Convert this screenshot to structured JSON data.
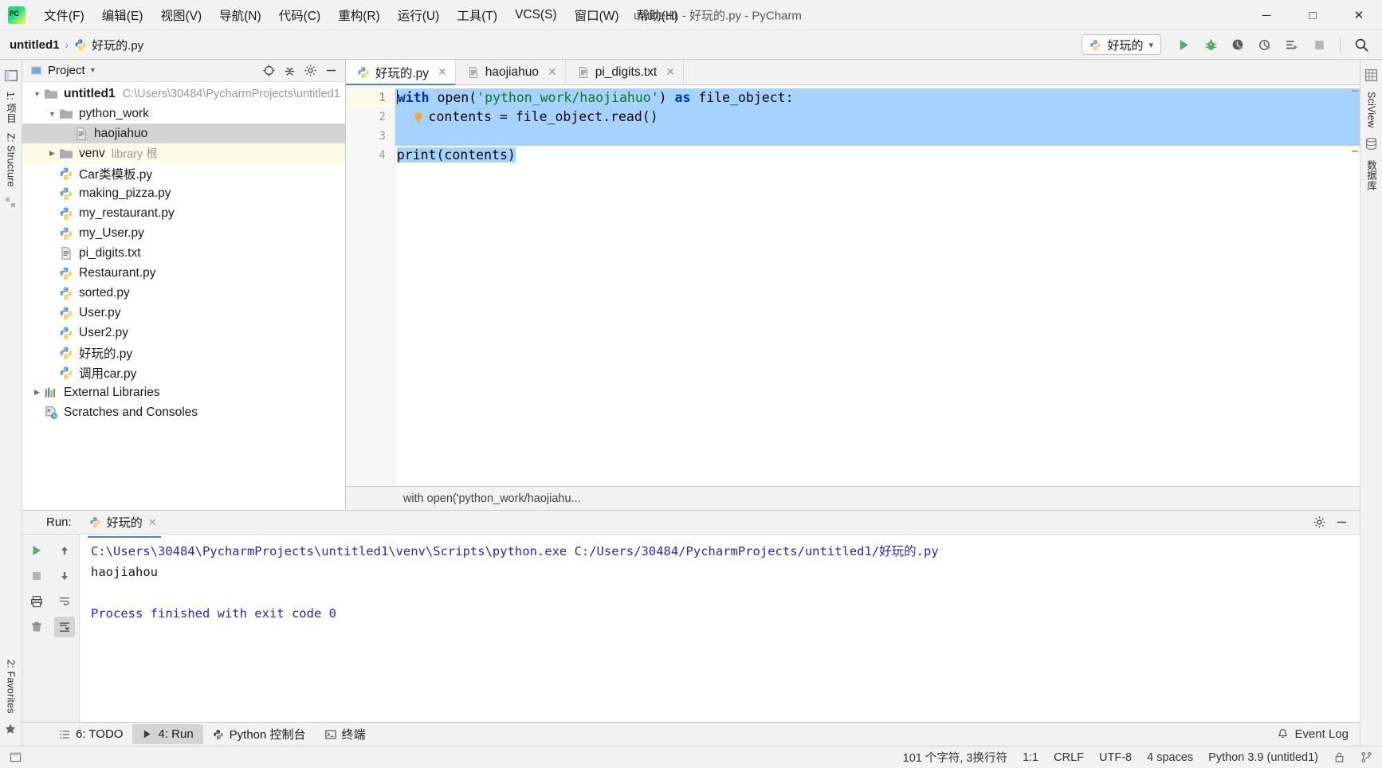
{
  "window": {
    "title": "untitled1 - 好玩的.py - PyCharm",
    "minimize": "─",
    "maximize": "□",
    "close": "✕"
  },
  "menubar": [
    {
      "label": "文件(F)",
      "key": "F"
    },
    {
      "label": "编辑(E)",
      "key": "E"
    },
    {
      "label": "视图(V)",
      "key": "V"
    },
    {
      "label": "导航(N)",
      "key": "N"
    },
    {
      "label": "代码(C)",
      "key": "C"
    },
    {
      "label": "重构(R)",
      "key": "R"
    },
    {
      "label": "运行(U)",
      "key": "U"
    },
    {
      "label": "工具(T)",
      "key": "T"
    },
    {
      "label": "VCS(S)",
      "key": "S"
    },
    {
      "label": "窗口(W)",
      "key": "W"
    },
    {
      "label": "帮助(H)",
      "key": "H"
    }
  ],
  "navbar": {
    "project_crumb": "untitled1",
    "separator": "›",
    "file_crumb": "好玩的.py"
  },
  "toolbar": {
    "run_config_label": "好玩的",
    "dropdown_caret": "▾",
    "buttons": [
      {
        "name": "run-button",
        "label": "Run"
      },
      {
        "name": "debug-button",
        "label": "Debug"
      },
      {
        "name": "run-with-coverage-button",
        "label": "Run with Coverage"
      },
      {
        "name": "profile-button",
        "label": "Profile"
      },
      {
        "name": "run-tests-button",
        "label": "Run Tests"
      },
      {
        "name": "stop-button",
        "label": "Stop"
      },
      {
        "name": "search-everywhere-button",
        "label": "Search Everywhere"
      }
    ]
  },
  "left_rail": {
    "top_tabs": [
      "1: 项目"
    ],
    "mid_tabs": [
      "Z: Structure"
    ],
    "bottom_tabs": [
      "2: Favorites"
    ]
  },
  "right_rail": {
    "tabs": [
      "SciView",
      "数据库"
    ]
  },
  "project_panel": {
    "title": "Project",
    "caret": "▾",
    "actions": [
      {
        "name": "select-opened-file-icon",
        "label": "Select Opened File"
      },
      {
        "name": "collapse-all-icon",
        "label": "Collapse All"
      },
      {
        "name": "settings-gear-icon",
        "label": "Settings"
      },
      {
        "name": "hide-panel-icon",
        "label": "Hide"
      }
    ],
    "tree": [
      {
        "indent": 0,
        "arrow": "open",
        "icon": "folder",
        "label": "untitled1",
        "bold": true,
        "path": "C:\\Users\\30484\\PycharmProjects\\untitled1",
        "state": "normal"
      },
      {
        "indent": 1,
        "arrow": "open",
        "icon": "folder",
        "label": "python_work",
        "bold": false,
        "path": "",
        "state": "normal"
      },
      {
        "indent": 2,
        "arrow": "none",
        "icon": "textfile",
        "label": "haojiahuo",
        "bold": false,
        "path": "",
        "state": "selected"
      },
      {
        "indent": 1,
        "arrow": "closed",
        "icon": "folder",
        "label": "venv",
        "bold": false,
        "sub": "library 根",
        "state": "highlight"
      },
      {
        "indent": 1,
        "arrow": "none",
        "icon": "python",
        "label": "Car类模板.py",
        "bold": false,
        "path": "",
        "state": "normal"
      },
      {
        "indent": 1,
        "arrow": "none",
        "icon": "python",
        "label": "making_pizza.py",
        "bold": false,
        "path": "",
        "state": "normal"
      },
      {
        "indent": 1,
        "arrow": "none",
        "icon": "python",
        "label": "my_restaurant.py",
        "bold": false,
        "path": "",
        "state": "normal"
      },
      {
        "indent": 1,
        "arrow": "none",
        "icon": "python",
        "label": "my_User.py",
        "bold": false,
        "path": "",
        "state": "normal"
      },
      {
        "indent": 1,
        "arrow": "none",
        "icon": "textfile",
        "label": "pi_digits.txt",
        "bold": false,
        "path": "",
        "state": "normal"
      },
      {
        "indent": 1,
        "arrow": "none",
        "icon": "python",
        "label": "Restaurant.py",
        "bold": false,
        "path": "",
        "state": "normal"
      },
      {
        "indent": 1,
        "arrow": "none",
        "icon": "python",
        "label": "sorted.py",
        "bold": false,
        "path": "",
        "state": "normal"
      },
      {
        "indent": 1,
        "arrow": "none",
        "icon": "python",
        "label": "User.py",
        "bold": false,
        "path": "",
        "state": "normal"
      },
      {
        "indent": 1,
        "arrow": "none",
        "icon": "python",
        "label": "User2.py",
        "bold": false,
        "path": "",
        "state": "normal"
      },
      {
        "indent": 1,
        "arrow": "none",
        "icon": "python",
        "label": "好玩的.py",
        "bold": false,
        "path": "",
        "state": "normal"
      },
      {
        "indent": 1,
        "arrow": "none",
        "icon": "python",
        "label": "调用car.py",
        "bold": false,
        "path": "",
        "state": "normal"
      },
      {
        "indent": 0,
        "arrow": "closed",
        "icon": "library",
        "label": "External Libraries",
        "bold": false,
        "path": "",
        "state": "normal"
      },
      {
        "indent": 0,
        "arrow": "none",
        "icon": "scratch",
        "label": "Scratches and Consoles",
        "bold": false,
        "path": "",
        "state": "normal"
      }
    ]
  },
  "editor": {
    "tabs": [
      {
        "label": "好玩的.py",
        "icon": "python",
        "active": true,
        "close": "✕"
      },
      {
        "label": "haojiahuo",
        "icon": "textfile",
        "active": false,
        "close": "✕"
      },
      {
        "label": "pi_digits.txt",
        "icon": "textfile",
        "active": false,
        "close": "✕"
      }
    ],
    "gutter_lines": [
      "1",
      "2",
      "3",
      "4"
    ],
    "lines": [
      {
        "n": 1,
        "tokens": [
          {
            "t": "with ",
            "c": "kw"
          },
          {
            "t": "open(",
            "c": "plain"
          },
          {
            "t": "'python_work/haojiahuo'",
            "c": "str"
          },
          {
            "t": ") ",
            "c": "plain"
          },
          {
            "t": "as ",
            "c": "kw"
          },
          {
            "t": "file_object:",
            "c": "plain"
          }
        ]
      },
      {
        "n": 2,
        "tokens": [
          {
            "t": "    contents = file_object.read()",
            "c": "plain"
          }
        ]
      },
      {
        "n": 3,
        "tokens": [
          {
            "t": "",
            "c": "plain"
          }
        ]
      },
      {
        "n": 4,
        "tokens": [
          {
            "t": "print(contents)",
            "c": "plain"
          }
        ]
      }
    ],
    "hint": "with open('python_work/haojiahu...",
    "bulb_line": 2
  },
  "run_panel": {
    "label": "Run:",
    "tab_label": "好玩的",
    "tab_close": "✕",
    "side_buttons": [
      {
        "name": "rerun-button",
        "label": "Rerun"
      },
      {
        "name": "stop-process-button",
        "label": "Stop"
      },
      {
        "name": "print-button",
        "label": "Print"
      },
      {
        "name": "trash-button",
        "label": "Clear All"
      },
      {
        "name": "up-stack-button",
        "label": "Up the Stack Trace"
      },
      {
        "name": "down-stack-button",
        "label": "Down the Stack Trace"
      },
      {
        "name": "soft-wrap-button",
        "label": "Soft-Wrap"
      },
      {
        "name": "scroll-to-end-button",
        "label": "Scroll to End"
      }
    ],
    "head_actions": [
      {
        "name": "settings-gear-icon",
        "label": "Settings"
      },
      {
        "name": "hide-panel-icon",
        "label": "Hide"
      }
    ],
    "console": [
      {
        "text": "C:\\Users\\30484\\PycharmProjects\\untitled1\\venv\\Scripts\\python.exe C:/Users/30484/PycharmProjects/untitled1/好玩的.py",
        "style": "cmd"
      },
      {
        "text": "haojiahou",
        "style": "out"
      },
      {
        "text": "",
        "style": "out"
      },
      {
        "text": "Process finished with exit code 0",
        "style": "fin"
      }
    ]
  },
  "tool_windows": [
    {
      "label": "6: TODO",
      "icon": "todo-icon",
      "active": false
    },
    {
      "label": "4: Run",
      "icon": "run-icon",
      "active": true
    },
    {
      "label": "Python 控制台",
      "icon": "python-icon",
      "active": false
    },
    {
      "label": "终端",
      "icon": "terminal-icon",
      "active": false
    }
  ],
  "event_log": {
    "label": "Event Log",
    "icon": "bell-icon"
  },
  "statusbar": {
    "char_count": "101 个字符, 3换行符",
    "caret_pos": "1:1",
    "line_sep": "CRLF",
    "encoding": "UTF-8",
    "indent": "4 spaces",
    "interpreter": "Python 3.9 (untitled1)",
    "lock_icon": "lock-icon",
    "branch_icon": "branch-icon"
  },
  "colors": {
    "accent_blue": "#4a86c8",
    "selection_blue": "#a6d2ff",
    "green": "#21a366",
    "keyword": "#0033b3",
    "string": "#067d17",
    "console_blue": "#2b25c9",
    "panel_bg": "#f2f2f2",
    "editor_bg": "#ffffff"
  }
}
